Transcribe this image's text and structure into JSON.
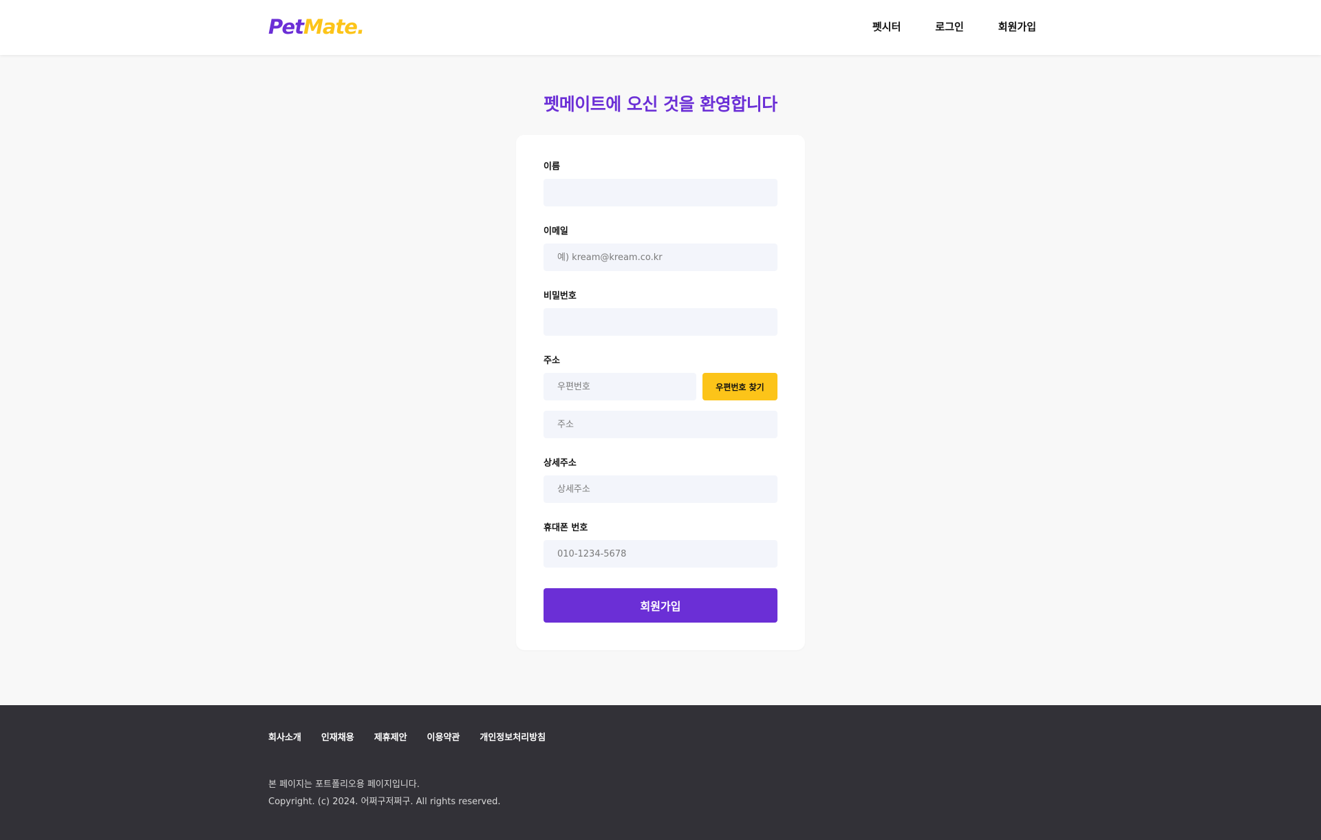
{
  "header": {
    "logo_pet": "Pet",
    "logo_mate": "Mate.",
    "nav": [
      {
        "label": "펫시터"
      },
      {
        "label": "로그인"
      },
      {
        "label": "회원가입"
      }
    ]
  },
  "page": {
    "title": "펫메이트에 오신 것을 환영합니다"
  },
  "form": {
    "name": {
      "label": "이름",
      "placeholder": "",
      "value": ""
    },
    "email": {
      "label": "이메일",
      "placeholder": "예) kream@kream.co.kr",
      "value": ""
    },
    "password": {
      "label": "비밀번호",
      "placeholder": "",
      "value": ""
    },
    "address": {
      "label": "주소",
      "zip_placeholder": "우편번호",
      "zip_button": "우편번호 찾기",
      "address_placeholder": "주소"
    },
    "detail_address": {
      "label": "상세주소",
      "placeholder": "상세주소"
    },
    "phone": {
      "label": "휴대폰 번호",
      "placeholder": "010-1234-5678"
    },
    "submit_label": "회원가입"
  },
  "footer": {
    "links": [
      {
        "label": "회사소개"
      },
      {
        "label": "인재채용"
      },
      {
        "label": "제휴제안"
      },
      {
        "label": "이용약관"
      },
      {
        "label": "개인정보처리방침"
      }
    ],
    "notice": "본 페이지는 포트폴리오용 페이지입니다.",
    "copyright": "Copyright. (c) 2024. 어쩌구저쩌구. All rights reserved."
  },
  "colors": {
    "brand_purple": "#6b2fd6",
    "brand_yellow": "#fcc419",
    "footer_bg": "#323137",
    "input_bg": "#f3f5fb"
  }
}
